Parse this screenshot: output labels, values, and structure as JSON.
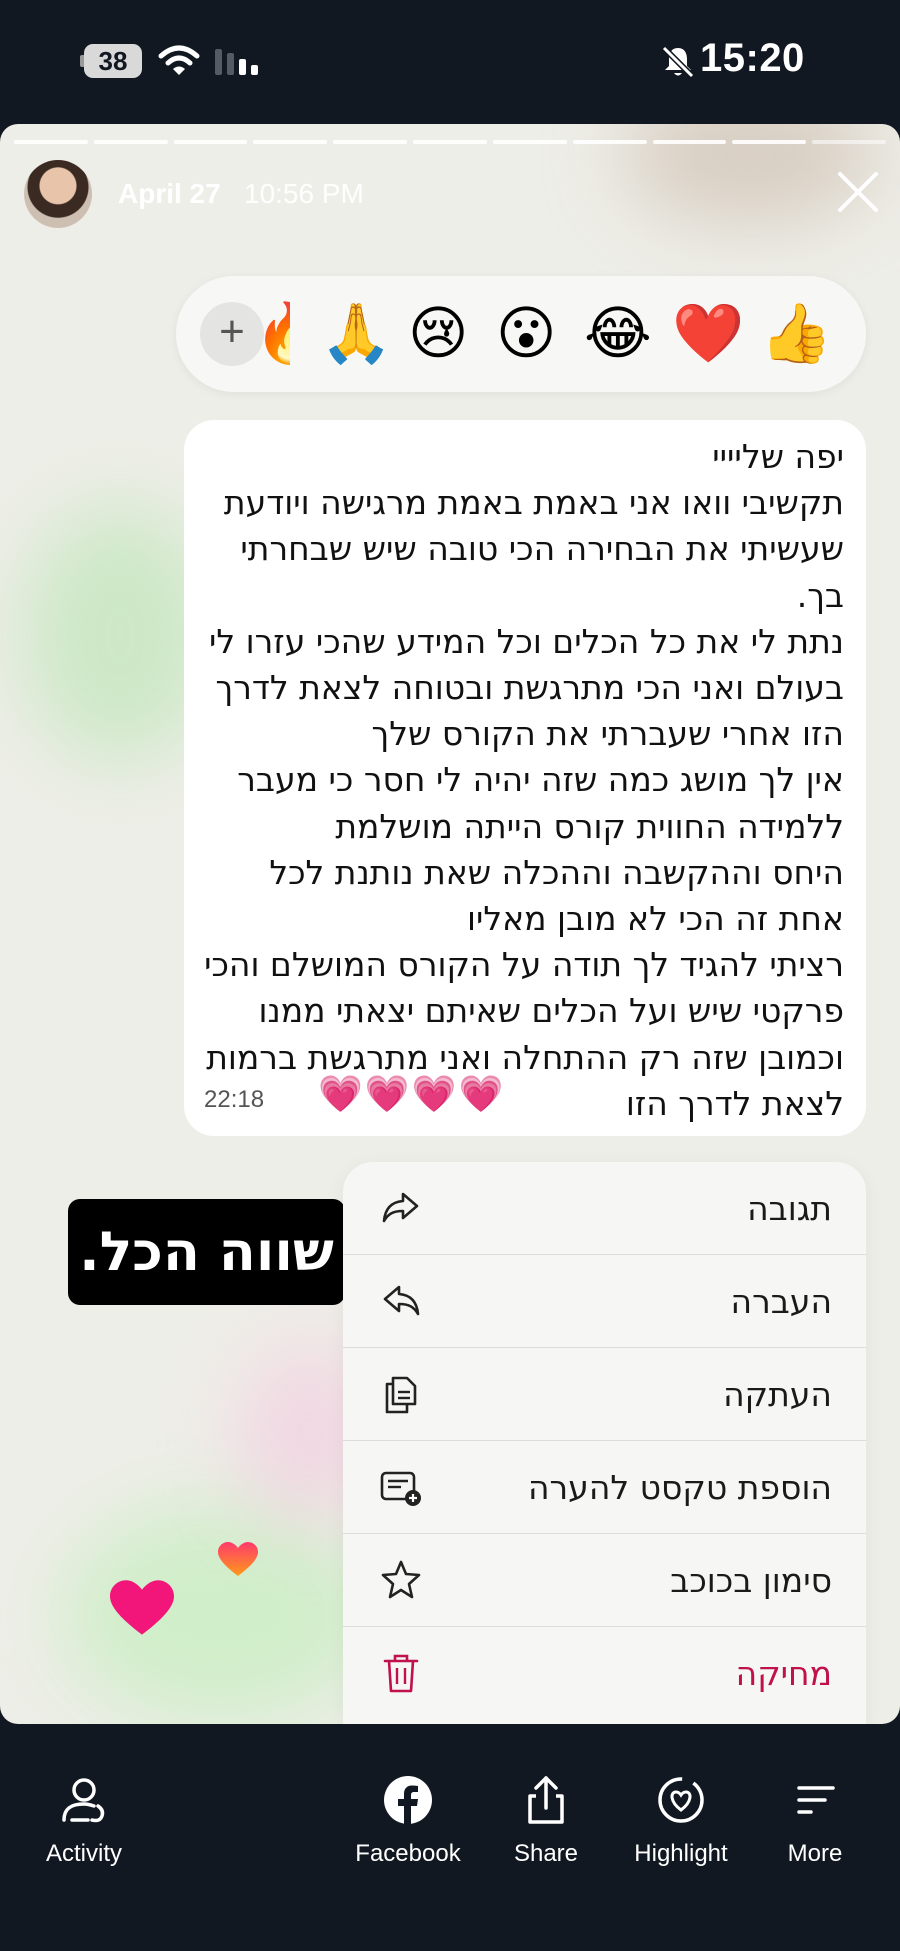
{
  "status_bar": {
    "battery": "38",
    "time": "15:20"
  },
  "story": {
    "date": "April 27",
    "time": "10:56 PM",
    "sticker_text": "שווה הכל."
  },
  "reactions": {
    "add_label": "+",
    "emojis": [
      "🔥",
      "🙏",
      "😢",
      "😮",
      "😂",
      "❤️",
      "👍"
    ]
  },
  "message": {
    "text": "יפה שליייי\nתקשיבי וואו אני באמת באמת מרגישה ויודעת שעשיתי את הבחירה הכי טובה שיש שבחרתי בך.\nנתת לי את כל הכלים וכל המידע שהכי עזרו לי בעולם ואני הכי מתרגשת ובטוחה לצאת לדרך הזו אחרי שעברתי את הקורס שלך\nאין לך מושג כמה שזה יהיה לי חסר כי מעבר ללמידה החווית קורס הייתה מושלמת\nהיחס וההקשבה וההכלה שאת נותנת לכל אחת זה הכי לא מובן מאליו\nרציתי להגיד לך תודה על הקורס המושלם והכי פרקטי שיש ועל הכלים שאיתם יצאתי ממנו וכמובן שזה רק ההתחלה ואני מתרגשת ברמות לצאת לדרך הזו",
    "hearts": "💗💗💗💗",
    "time": "22:18"
  },
  "menu": {
    "items": [
      {
        "label": "תגובה",
        "icon": "reply-share-icon"
      },
      {
        "label": "העברה",
        "icon": "forward-back-arrow-icon"
      },
      {
        "label": "העתקה",
        "icon": "copy-icon"
      },
      {
        "label": "הוספת טקסט להערה",
        "icon": "add-note-icon"
      },
      {
        "label": "סימון בכוכב",
        "icon": "star-icon"
      },
      {
        "label": "מחיקה",
        "icon": "trash-icon"
      }
    ],
    "danger_color": "#c0104d"
  },
  "bottom_nav": {
    "activity": "Activity",
    "facebook": "Facebook",
    "share": "Share",
    "highlight": "Highlight",
    "more": "More"
  }
}
